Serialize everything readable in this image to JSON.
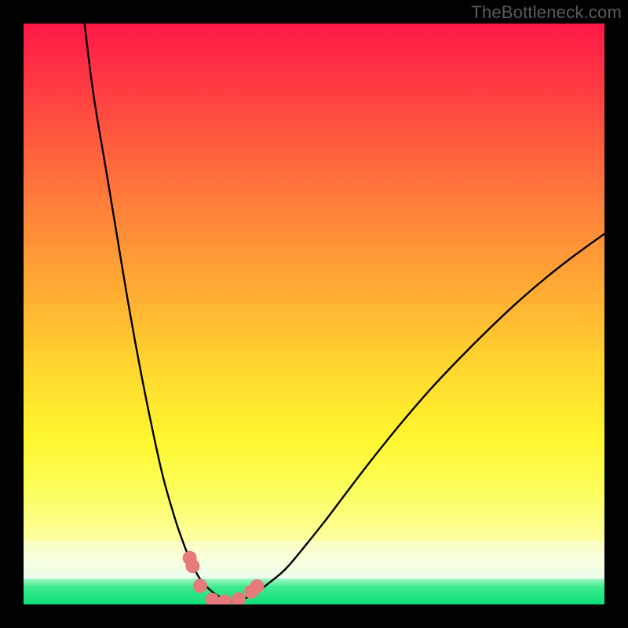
{
  "watermark": "TheBottleneck.com",
  "chart_data": {
    "type": "line",
    "title": "",
    "xlabel": "",
    "ylabel": "",
    "xlim": [
      0,
      100
    ],
    "ylim": [
      0,
      100
    ],
    "grid": false,
    "legend": false,
    "series": [
      {
        "name": "left-curve",
        "x": [
          10.5,
          12,
          14,
          16,
          18,
          20,
          22,
          24,
          26,
          27,
          28,
          29,
          30,
          31,
          32,
          33,
          34,
          35,
          36
        ],
        "values": [
          100,
          88,
          76,
          64,
          52,
          41,
          31,
          22,
          15,
          12,
          9.3,
          7,
          5,
          3.6,
          2.6,
          1.8,
          1.2,
          0.8,
          0.5
        ]
      },
      {
        "name": "right-curve",
        "x": [
          36,
          38,
          40,
          42,
          45,
          48,
          52,
          56,
          60,
          65,
          70,
          75,
          80,
          85,
          90,
          95,
          100
        ],
        "values": [
          0.5,
          1.0,
          2.0,
          3.5,
          6.0,
          9.5,
          14.5,
          19.8,
          25,
          31.2,
          37,
          42.3,
          47.3,
          52,
          56.3,
          60.2,
          63.8
        ]
      }
    ],
    "markers": {
      "name": "bottom-markers",
      "x": [
        28.6,
        29.1,
        30.4,
        32.5,
        34.6,
        37.0,
        39.2,
        40.2
      ],
      "values": [
        8.0,
        6.6,
        3.2,
        0.8,
        0.5,
        0.9,
        2.2,
        3.1
      ],
      "color": "#e77a7a",
      "radius": 9
    },
    "background_gradient": {
      "stops": [
        {
          "pos": 0.0,
          "color": "#ff1846"
        },
        {
          "pos": 0.08,
          "color": "#ff2f45"
        },
        {
          "pos": 0.22,
          "color": "#ff593e"
        },
        {
          "pos": 0.36,
          "color": "#ff823a"
        },
        {
          "pos": 0.52,
          "color": "#ffad33"
        },
        {
          "pos": 0.66,
          "color": "#ffd52f"
        },
        {
          "pos": 0.8,
          "color": "#fff62e"
        },
        {
          "pos": 0.895,
          "color": "#fcffa0"
        },
        {
          "pos": 0.93,
          "color": "#eefff0"
        },
        {
          "pos": 0.955,
          "color": "#a2f7c4"
        },
        {
          "pos": 1.0,
          "color": "#0de07a"
        }
      ]
    }
  }
}
